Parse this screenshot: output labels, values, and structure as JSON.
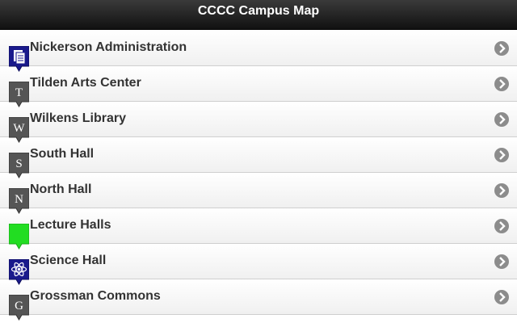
{
  "header": {
    "title": "CCCC Campus Map"
  },
  "colors": {
    "gray_marker": "#555555",
    "blue_marker": "#1a1a8c",
    "green_marker": "#22dd22"
  },
  "items": [
    {
      "label": "Nickerson Administration",
      "marker": "document-icon",
      "letter": "",
      "color": "#1a1a8c"
    },
    {
      "label": "Tilden Arts Center",
      "marker": "letter",
      "letter": "T",
      "color": "#555555"
    },
    {
      "label": "Wilkens Library",
      "marker": "letter",
      "letter": "W",
      "color": "#555555"
    },
    {
      "label": "South Hall",
      "marker": "letter",
      "letter": "S",
      "color": "#555555"
    },
    {
      "label": "North Hall",
      "marker": "letter",
      "letter": "N",
      "color": "#555555"
    },
    {
      "label": "Lecture Halls",
      "marker": "plain",
      "letter": "",
      "color": "#22dd22"
    },
    {
      "label": "Science Hall",
      "marker": "atom-icon",
      "letter": "",
      "color": "#1a1a8c"
    },
    {
      "label": "Grossman Commons",
      "marker": "letter",
      "letter": "G",
      "color": "#555555"
    }
  ]
}
